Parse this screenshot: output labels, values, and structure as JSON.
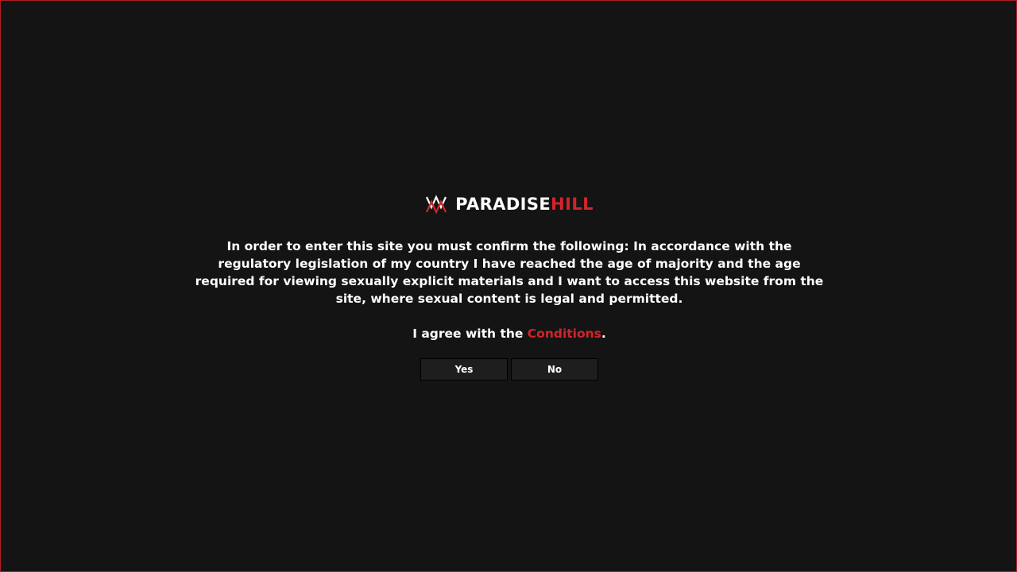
{
  "logo": {
    "name_part1": "PARADISE",
    "name_part2": "HILL"
  },
  "statement": "In order to enter this site you must confirm the following: In accordance with the regulatory legislation of my country I have reached the age of majority and the age required for viewing sexually explicit materials and I want to access this website from the site, where sexual content is legal and permitted.",
  "agree": {
    "prefix": "I agree with the ",
    "link_label": "Conditions",
    "suffix": "."
  },
  "buttons": {
    "yes_label": "Yes",
    "no_label": "No"
  },
  "colors": {
    "background": "#141414",
    "accent": "#d3232b",
    "text": "#ffffff",
    "button_bg": "#1e1e1e"
  }
}
